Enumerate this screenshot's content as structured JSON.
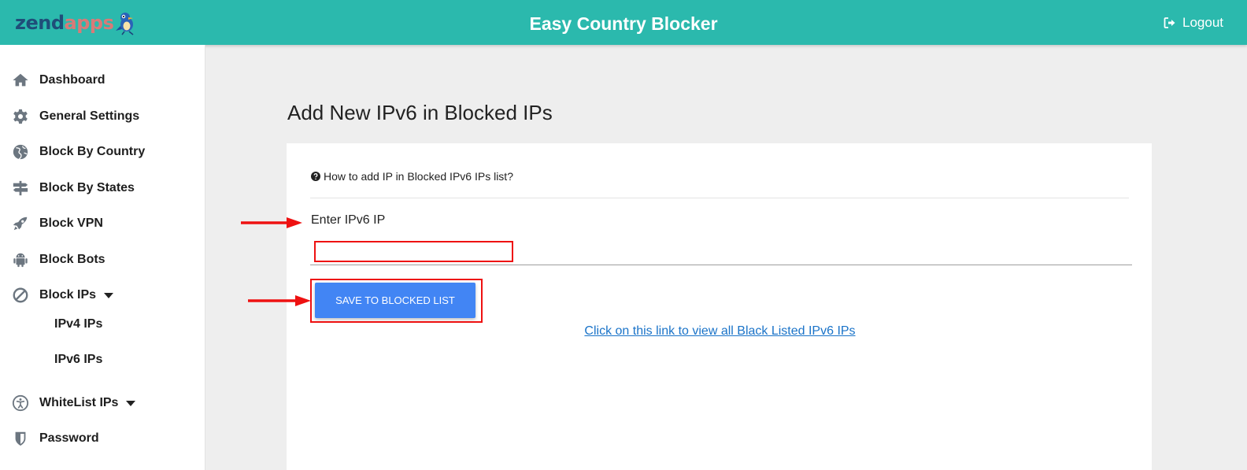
{
  "header": {
    "logo_part1": "zend",
    "logo_part2": "apps",
    "title": "Easy Country Blocker",
    "logout_label": "Logout",
    "logout_icon": "sign-out-icon",
    "bg_color": "#2bb9ad"
  },
  "sidebar": {
    "items": [
      {
        "label": "Dashboard",
        "icon": "home-icon"
      },
      {
        "label": "General Settings",
        "icon": "gear-icon"
      },
      {
        "label": "Block By Country",
        "icon": "globe-icon"
      },
      {
        "label": "Block By States",
        "icon": "signpost-icon"
      },
      {
        "label": "Block VPN",
        "icon": "rocket-icon"
      },
      {
        "label": "Block Bots",
        "icon": "android-icon"
      },
      {
        "label": "Block IPs",
        "icon": "ban-icon"
      },
      {
        "label": "WhiteList IPs",
        "icon": "accessibility-icon"
      },
      {
        "label": "Password",
        "icon": "shield-icon"
      }
    ],
    "subitems": [
      {
        "label": "IPv4 IPs"
      },
      {
        "label": "IPv6 IPs"
      }
    ]
  },
  "main": {
    "heading": "Add New IPv6 in Blocked IPs",
    "help_text": "How to add IP in Blocked IPv6 IPs list?",
    "help_icon": "question-circle-icon",
    "field_label": "Enter IPv6 IP",
    "field_value": "",
    "save_label": "SAVE TO BLOCKED LIST",
    "view_link": "Click on this link to view all Black Listed IPv6 IPs"
  },
  "colors": {
    "accent_button": "#4285f4",
    "highlight": "#ee1111",
    "link": "#1a73c8"
  }
}
